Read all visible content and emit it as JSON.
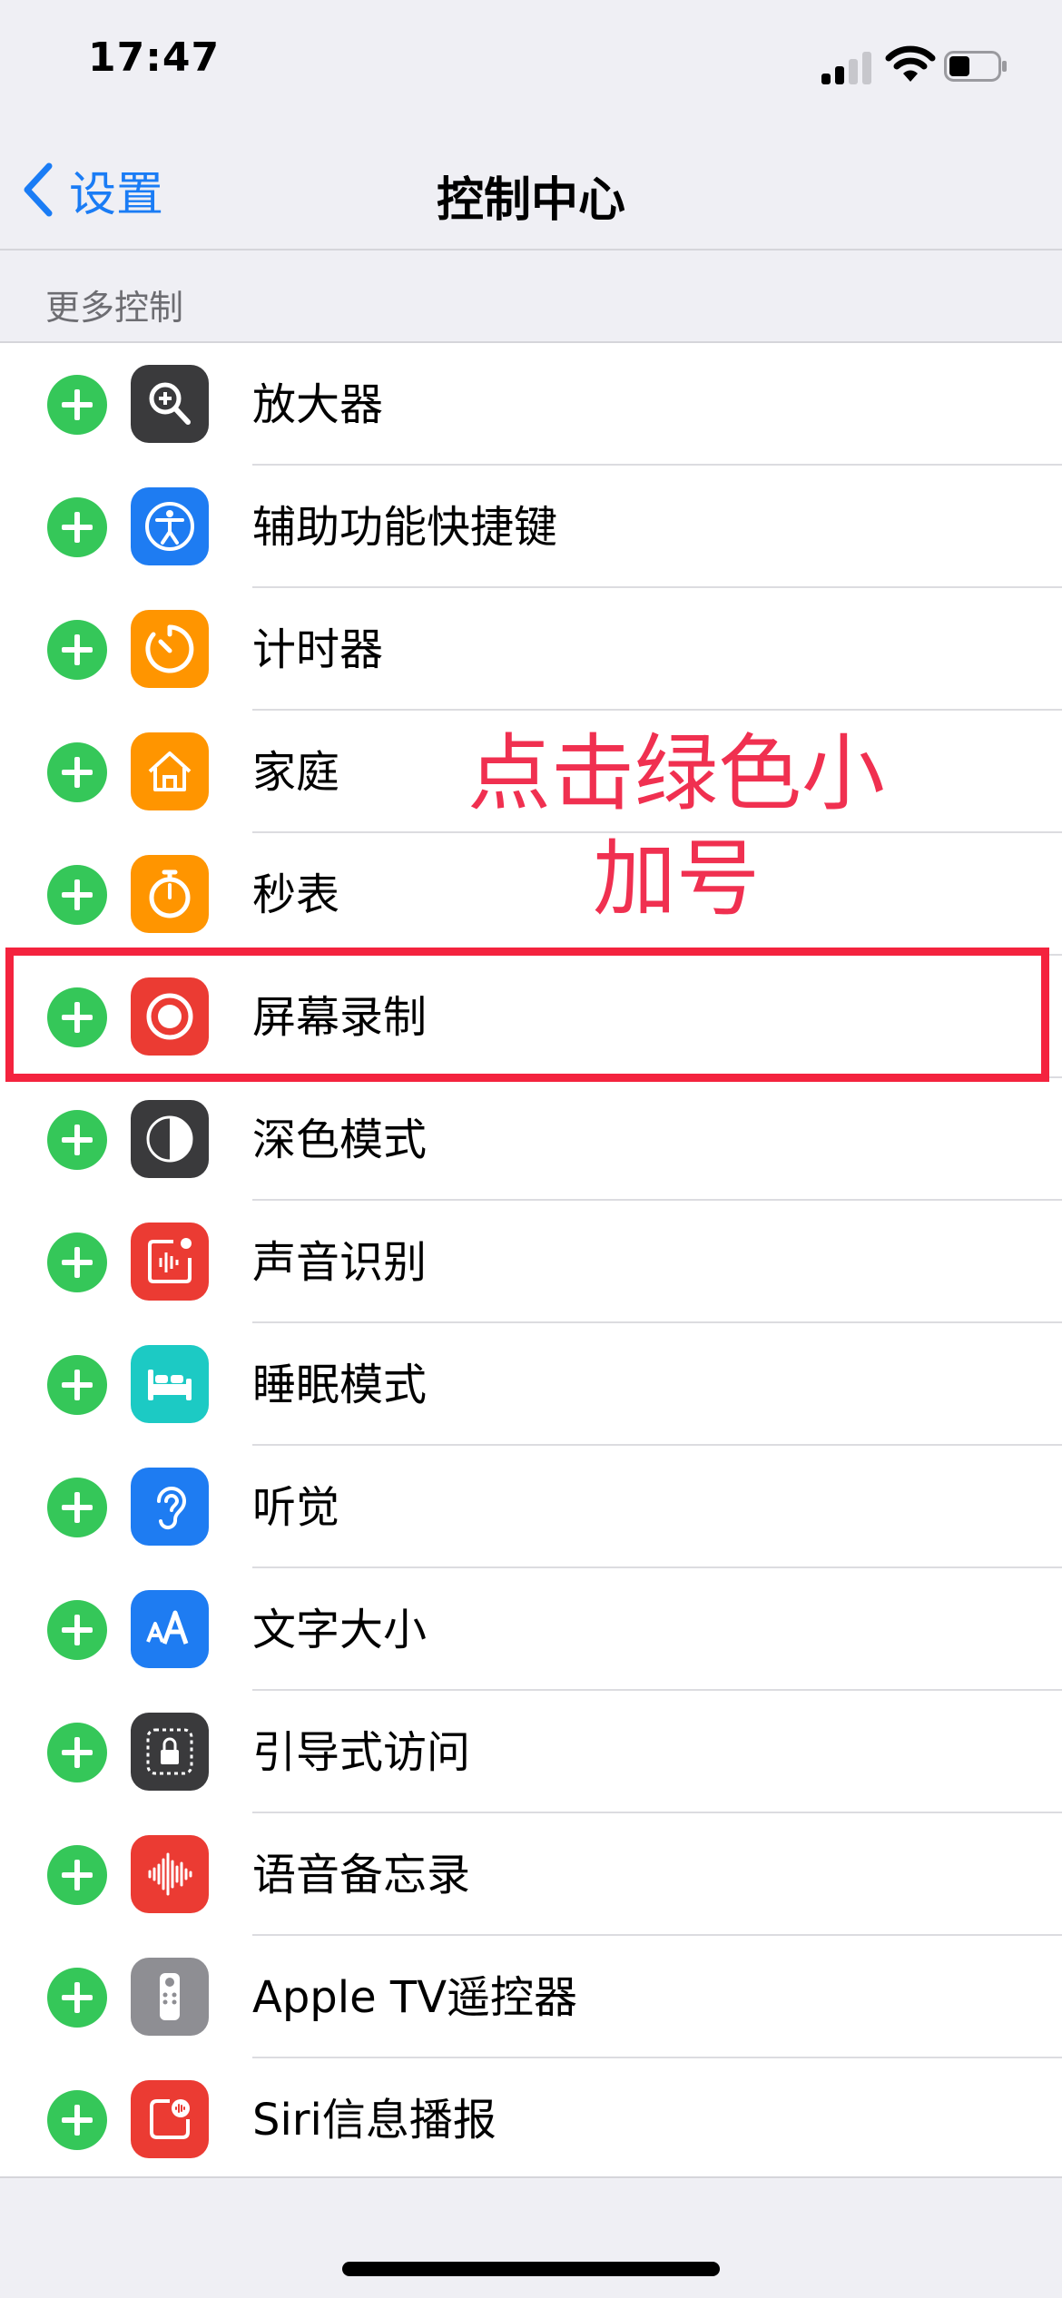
{
  "status_bar": {
    "time": "17:47"
  },
  "nav": {
    "back_label": "设置",
    "title": "控制中心"
  },
  "section_header": "更多控制",
  "items": [
    {
      "label": "放大器",
      "icon": "magnifier-icon",
      "color": "#3a3a3c"
    },
    {
      "label": "辅助功能快捷键",
      "icon": "accessibility-icon",
      "color": "#1e7cf2"
    },
    {
      "label": "计时器",
      "icon": "timer-icon",
      "color": "#ff9500"
    },
    {
      "label": "家庭",
      "icon": "home-icon",
      "color": "#ff9500"
    },
    {
      "label": "秒表",
      "icon": "stopwatch-icon",
      "color": "#ff9500"
    },
    {
      "label": "屏幕录制",
      "icon": "screen-record-icon",
      "color": "#eb3b33"
    },
    {
      "label": "深色模式",
      "icon": "dark-mode-icon",
      "color": "#3a3a3c"
    },
    {
      "label": "声音识别",
      "icon": "sound-recognition-icon",
      "color": "#eb3b33"
    },
    {
      "label": "睡眠模式",
      "icon": "bed-icon",
      "color": "#1ccac4"
    },
    {
      "label": "听觉",
      "icon": "ear-icon",
      "color": "#1e7cf2"
    },
    {
      "label": "文字大小",
      "icon": "text-size-icon",
      "color": "#1e7cf2"
    },
    {
      "label": "引导式访问",
      "icon": "guided-access-icon",
      "color": "#3a3a3c"
    },
    {
      "label": "语音备忘录",
      "icon": "voice-memo-icon",
      "color": "#eb3b33"
    },
    {
      "label": "Apple TV遥控器",
      "icon": "tv-remote-icon",
      "color": "#8e8e93"
    },
    {
      "label": "Siri信息播报",
      "icon": "siri-announce-icon",
      "color": "#eb3b33"
    }
  ],
  "annotation": {
    "line1": "点击绿色小",
    "line2": "加号"
  },
  "colors": {
    "accent": "#1a7cf5",
    "add_green": "#35c759",
    "annotation_red": "#f4233e"
  }
}
